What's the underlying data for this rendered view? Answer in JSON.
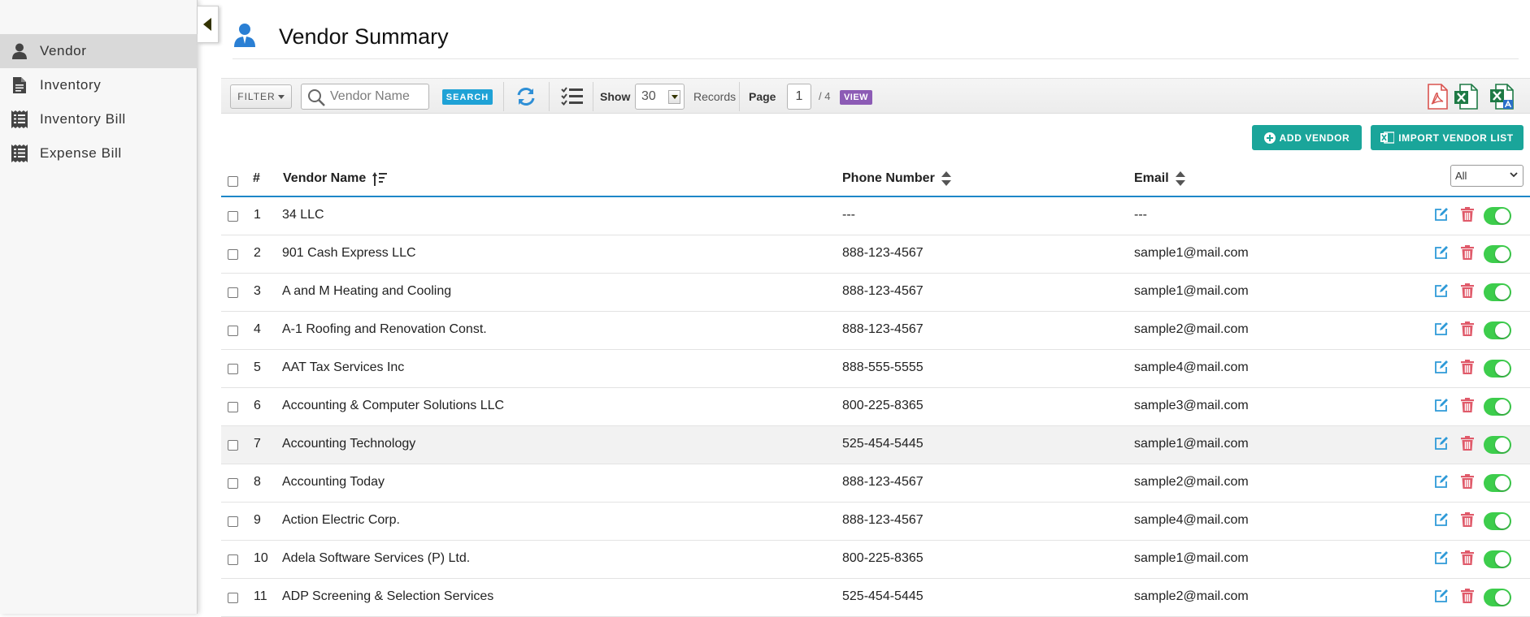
{
  "sidebar": {
    "items": [
      {
        "label": "Vendor",
        "icon": "user-icon",
        "active": true
      },
      {
        "label": "Inventory",
        "icon": "document-icon",
        "active": false
      },
      {
        "label": "Inventory Bill",
        "icon": "receipt-icon",
        "active": false
      },
      {
        "label": "Expense Bill",
        "icon": "receipt-icon",
        "active": false
      }
    ]
  },
  "header": {
    "title": "Vendor Summary",
    "icon": "vendor-user-icon"
  },
  "toolbar": {
    "filter_label": "FILTER",
    "search_placeholder": "Vendor Name",
    "search_label": "SEARCH",
    "show_label": "Show",
    "show_value": "30",
    "records_label": "Records",
    "page_label": "Page",
    "page_value": "1",
    "page_total": "/ 4",
    "view_label": "VIEW",
    "export_icons": [
      "pdf-export-icon",
      "excel-export-icon",
      "excel-template-icon"
    ]
  },
  "actions": {
    "add_vendor": "ADD VENDOR",
    "import_vendor": "IMPORT VENDOR LIST"
  },
  "table": {
    "headers": {
      "index": "#",
      "vendor_name": "Vendor Name",
      "phone": "Phone Number",
      "email": "Email"
    },
    "status_filter": "All",
    "rows": [
      {
        "num": "1",
        "name": "34 LLC",
        "phone": "---",
        "email": "---"
      },
      {
        "num": "2",
        "name": "901 Cash Express LLC",
        "phone": "888-123-4567",
        "email": "sample1@mail.com"
      },
      {
        "num": "3",
        "name": "A and M Heating and Cooling",
        "phone": "888-123-4567",
        "email": "sample1@mail.com"
      },
      {
        "num": "4",
        "name": "A-1 Roofing and Renovation Const.",
        "phone": "888-123-4567",
        "email": "sample2@mail.com"
      },
      {
        "num": "5",
        "name": "AAT Tax Services Inc",
        "phone": "888-555-5555",
        "email": "sample4@mail.com"
      },
      {
        "num": "6",
        "name": "Accounting & Computer Solutions LLC",
        "phone": "800-225-8365",
        "email": "sample3@mail.com"
      },
      {
        "num": "7",
        "name": "Accounting Technology",
        "phone": "525-454-5445",
        "email": "sample1@mail.com"
      },
      {
        "num": "8",
        "name": "Accounting Today",
        "phone": "888-123-4567",
        "email": "sample2@mail.com"
      },
      {
        "num": "9",
        "name": "Action Electric Corp.",
        "phone": "888-123-4567",
        "email": "sample4@mail.com"
      },
      {
        "num": "10",
        "name": "Adela Software Services (P) Ltd.",
        "phone": "800-225-8365",
        "email": "sample1@mail.com"
      },
      {
        "num": "11",
        "name": "ADP Screening & Selection Services",
        "phone": "525-454-5445",
        "email": "sample2@mail.com"
      }
    ]
  },
  "colors": {
    "accent_blue": "#1d87c8",
    "teal": "#1aa59a",
    "search_blue": "#1fa2d6",
    "view_purple": "#8c5bb5",
    "toggle_green": "#3dcd4c",
    "delete_red": "#e05a6a",
    "edit_blue": "#2e9ad8"
  }
}
